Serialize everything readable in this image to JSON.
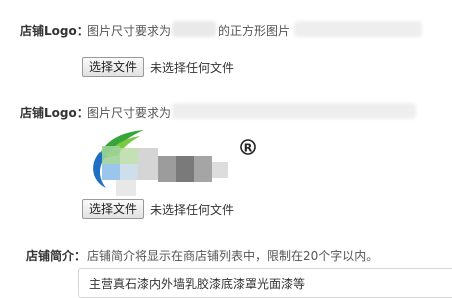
{
  "logo_field_1": {
    "label": "店铺Logo：",
    "hint_prefix": "图片尺寸要求为",
    "hint_suffix": "的正方形图片",
    "file_button": "选择文件",
    "file_status": "未选择任何文件"
  },
  "logo_field_2": {
    "label": "店铺Logo：",
    "hint_prefix": "图片尺寸要求为",
    "registered_mark": "®",
    "file_button": "选择文件",
    "file_status": "未选择任何文件"
  },
  "intro_field": {
    "label": "店铺简介：",
    "hint": "店铺简介将显示在商店铺列表中，限制在20个字以内。",
    "value": "主营真石漆内外墙乳胶漆底漆罩光面漆等"
  }
}
